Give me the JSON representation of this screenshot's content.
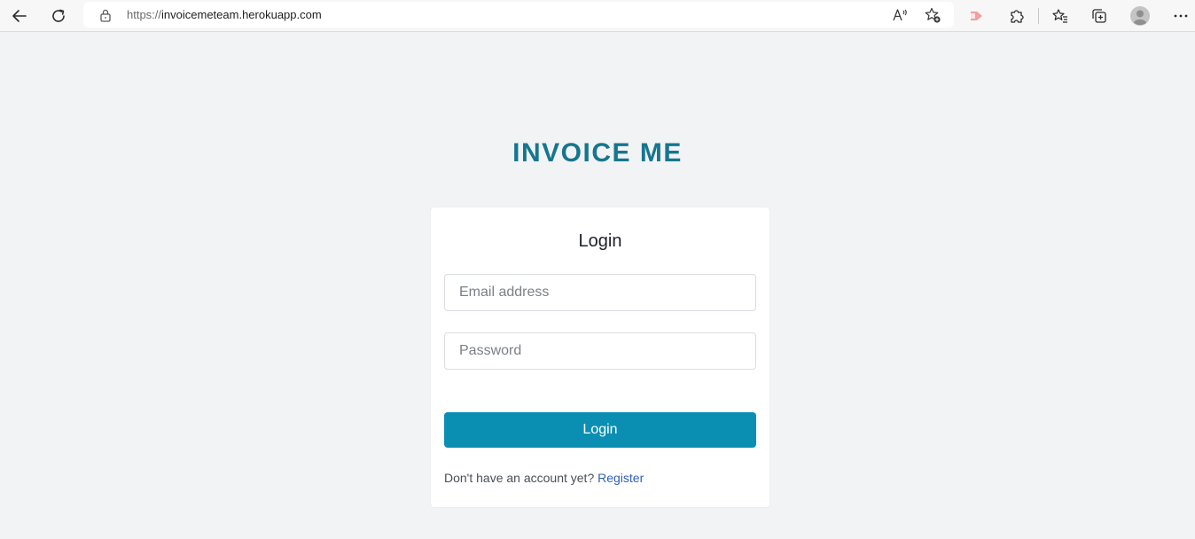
{
  "browser": {
    "url_scheme": "https://",
    "url_host": "invoicemeteam.herokuapp.com",
    "icons": {
      "back": "arrow-left-icon",
      "refresh": "refresh-icon",
      "lock": "lock-icon",
      "read_aloud": "read-aloud-icon",
      "favorite_add": "star-plus-icon",
      "extension_badge": "extension-badge-icon",
      "extensions": "puzzle-icon",
      "favorites": "favorites-icon",
      "collections": "collections-icon",
      "profile": "profile-icon",
      "more": "more-icon"
    }
  },
  "app": {
    "brand": "INVOICE ME",
    "brand_color": "#16768e"
  },
  "login": {
    "title": "Login",
    "email_placeholder": "Email address",
    "email_value": "",
    "password_placeholder": "Password",
    "password_value": "",
    "submit_label": "Login",
    "submit_color": "#0a8fb3",
    "register_prompt": "Don't have an account yet?",
    "register_link": "Register",
    "link_color": "#2f5fb7"
  }
}
